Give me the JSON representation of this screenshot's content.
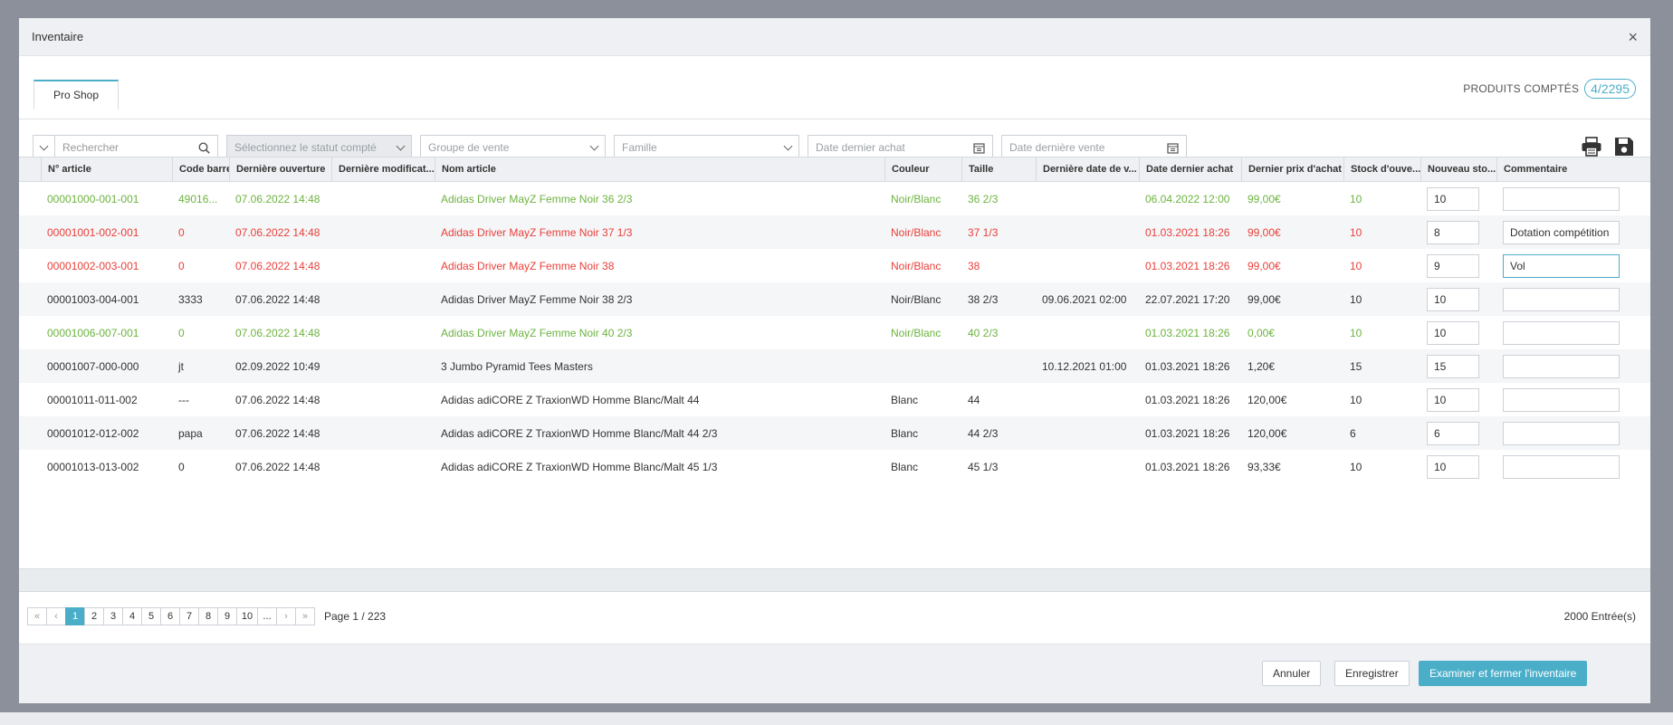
{
  "modal": {
    "title": "Inventaire",
    "close": "×"
  },
  "tabs": [
    {
      "label": "Pro Shop"
    }
  ],
  "counter": {
    "label": "PRODUITS COMPTÉS",
    "value": "4/2295"
  },
  "filters": {
    "search_placeholder": "Rechercher",
    "status_placeholder": "Sélectionnez le statut compté",
    "sales_group_placeholder": "Groupe de vente",
    "family_placeholder": "Famille",
    "last_purchase_placeholder": "Date dernier achat",
    "last_sale_placeholder": "Date dernière vente"
  },
  "columns": [
    "N° article",
    "Code barre",
    "Dernière ouverture",
    "Dernière modificat...",
    "Nom article",
    "Couleur",
    "Taille",
    "Dernière date de v...",
    "Date dernier achat",
    "Dernier prix d'achat",
    "Stock d'ouve...",
    "Nouveau sto...",
    "Commentaire"
  ],
  "rows": [
    {
      "state": "green",
      "article": "00001000-001-001",
      "barcode": "49016...",
      "opened": "07.06.2022 14:48",
      "modified": "",
      "name": "Adidas Driver MayZ Femme Noir 36 2/3",
      "color": "Noir/Blanc",
      "size": "36 2/3",
      "last_sale": "",
      "last_purchase": "06.04.2022 12:00",
      "price": "99,00€",
      "stock": "10",
      "new_stock": "10",
      "comment": ""
    },
    {
      "state": "red",
      "article": "00001001-002-001",
      "barcode": "0",
      "opened": "07.06.2022 14:48",
      "modified": "",
      "name": "Adidas Driver MayZ Femme Noir 37 1/3",
      "color": "Noir/Blanc",
      "size": "37 1/3",
      "last_sale": "",
      "last_purchase": "01.03.2021 18:26",
      "price": "99,00€",
      "stock": "10",
      "new_stock": "8",
      "comment": "Dotation compétition"
    },
    {
      "state": "red",
      "article": "00001002-003-001",
      "barcode": "0",
      "opened": "07.06.2022 14:48",
      "modified": "",
      "name": "Adidas Driver MayZ Femme Noir 38",
      "color": "Noir/Blanc",
      "size": "38",
      "last_sale": "",
      "last_purchase": "01.03.2021 18:26",
      "price": "99,00€",
      "stock": "10",
      "new_stock": "9",
      "comment": "Vol"
    },
    {
      "state": "normal",
      "article": "00001003-004-001",
      "barcode": "3333",
      "opened": "07.06.2022 14:48",
      "modified": "",
      "name": "Adidas Driver MayZ Femme Noir 38 2/3",
      "color": "Noir/Blanc",
      "size": "38 2/3",
      "last_sale": "09.06.2021 02:00",
      "last_purchase": "22.07.2021 17:20",
      "price": "99,00€",
      "stock": "10",
      "new_stock": "10",
      "comment": ""
    },
    {
      "state": "green",
      "article": "00001006-007-001",
      "barcode": "0",
      "opened": "07.06.2022 14:48",
      "modified": "",
      "name": "Adidas Driver MayZ Femme Noir 40 2/3",
      "color": "Noir/Blanc",
      "size": "40 2/3",
      "last_sale": "",
      "last_purchase": "01.03.2021 18:26",
      "price": "0,00€",
      "stock": "10",
      "new_stock": "10",
      "comment": ""
    },
    {
      "state": "normal",
      "article": "00001007-000-000",
      "barcode": "jt",
      "opened": "02.09.2022 10:49",
      "modified": "",
      "name": "3 Jumbo Pyramid Tees Masters",
      "color": "",
      "size": "",
      "last_sale": "10.12.2021 01:00",
      "last_purchase": "01.03.2021 18:26",
      "price": "1,20€",
      "stock": "15",
      "new_stock": "15",
      "comment": ""
    },
    {
      "state": "normal",
      "article": "00001011-011-002",
      "barcode": "---",
      "opened": "07.06.2022 14:48",
      "modified": "",
      "name": "Adidas adiCORE Z TraxionWD Homme Blanc/Malt 44",
      "color": "Blanc",
      "size": "44",
      "last_sale": "",
      "last_purchase": "01.03.2021 18:26",
      "price": "120,00€",
      "stock": "10",
      "new_stock": "10",
      "comment": ""
    },
    {
      "state": "normal",
      "article": "00001012-012-002",
      "barcode": "papa",
      "opened": "07.06.2022 14:48",
      "modified": "",
      "name": "Adidas adiCORE Z TraxionWD Homme Blanc/Malt 44 2/3",
      "color": "Blanc",
      "size": "44 2/3",
      "last_sale": "",
      "last_purchase": "01.03.2021 18:26",
      "price": "120,00€",
      "stock": "6",
      "new_stock": "6",
      "comment": ""
    },
    {
      "state": "normal",
      "article": "00001013-013-002",
      "barcode": "0",
      "opened": "07.06.2022 14:48",
      "modified": "",
      "name": "Adidas adiCORE Z TraxionWD Homme Blanc/Malt 45 1/3",
      "color": "Blanc",
      "size": "45 1/3",
      "last_sale": "",
      "last_purchase": "01.03.2021 18:26",
      "price": "93,33€",
      "stock": "10",
      "new_stock": "10",
      "comment": ""
    }
  ],
  "pagination": {
    "first": "«",
    "prev": "‹",
    "next": "›",
    "last": "»",
    "pages": [
      "1",
      "2",
      "3",
      "4",
      "5",
      "6",
      "7",
      "8",
      "9",
      "10",
      "..."
    ],
    "current": "1",
    "page_info": "Page 1 / 223",
    "entries": "2000 Entrée(s)"
  },
  "footer": {
    "cancel": "Annuler",
    "save": "Enregistrer",
    "review_close": "Examiner et fermer l'inventaire"
  },
  "colors": {
    "accent": "#4aaec9",
    "green": "#6cb33f",
    "red": "#e8403a"
  },
  "icons": [
    "close-icon",
    "search-icon",
    "chevron-down-icon",
    "calendar-icon",
    "print-icon",
    "save-icon"
  ]
}
